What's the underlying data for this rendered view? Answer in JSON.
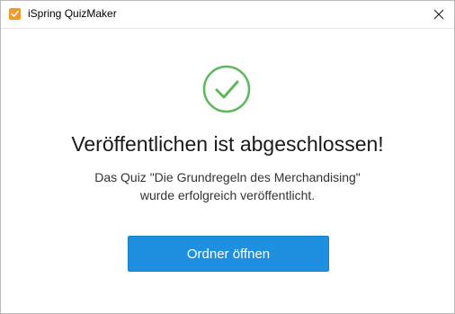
{
  "window": {
    "title": "iSpring QuizMaker",
    "icons": {
      "app": "ispring-app-icon",
      "close": "close-icon",
      "status": "check-circle-icon"
    }
  },
  "colors": {
    "accent": "#1f8fe0",
    "success": "#5cb85c",
    "app_icon": "#f39a2b"
  },
  "dialog": {
    "headline": "Veröffentlichen ist abgeschlossen!",
    "message_line1": "Das Quiz \"Die Grundregeln des Merchandising\"",
    "message_line2": "wurde erfolgreich veröffentlicht.",
    "open_folder_label": "Ordner öffnen"
  }
}
